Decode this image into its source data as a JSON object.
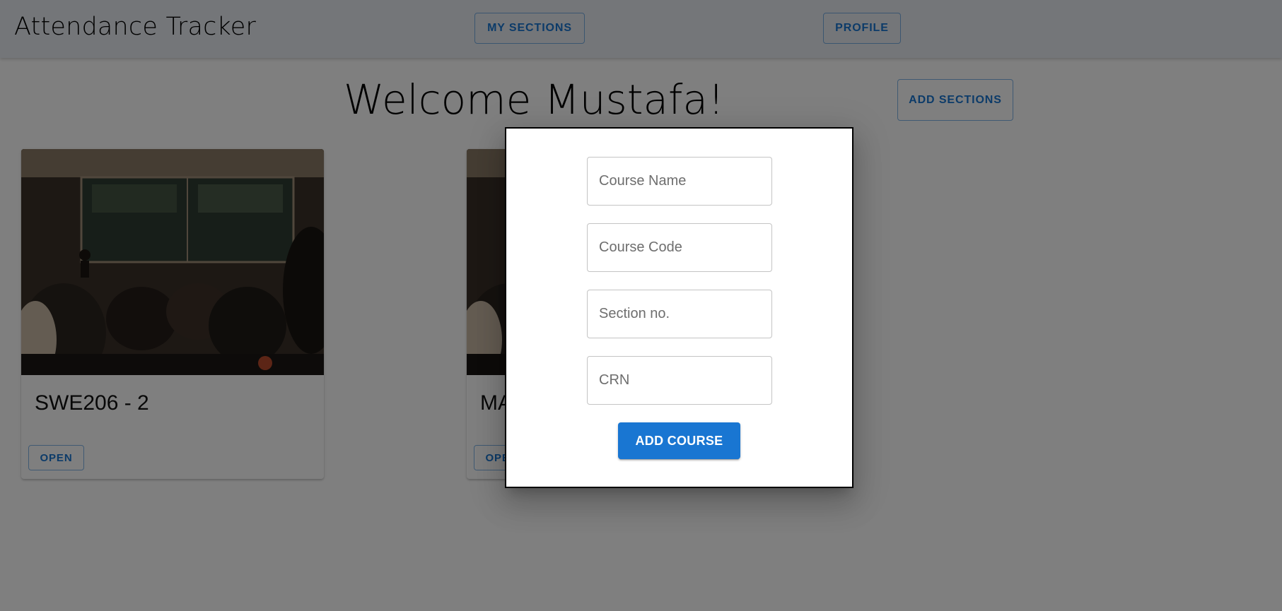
{
  "header": {
    "title": "Attendance Tracker",
    "nav": {
      "my_sections": "MY SECTIONS",
      "profile": "PROFILE"
    }
  },
  "main": {
    "welcome": "Welcome Mustafa!",
    "add_sections": "ADD SECTIONS",
    "cards": [
      {
        "title": "SWE206 - 2",
        "open_label": "OPEN"
      },
      {
        "title": "MA",
        "open_label": "OPEN"
      }
    ]
  },
  "dialog": {
    "fields": {
      "course_name": {
        "placeholder": "Course Name",
        "value": ""
      },
      "course_code": {
        "placeholder": "Course Code",
        "value": ""
      },
      "section_no": {
        "placeholder": "Section no.",
        "value": ""
      },
      "crn": {
        "placeholder": "CRN",
        "value": ""
      }
    },
    "submit_label": "ADD COURSE"
  },
  "colors": {
    "primary": "#1976d2",
    "appbar": "#e9edf3",
    "backdrop": "rgba(0,0,0,0.5)"
  }
}
